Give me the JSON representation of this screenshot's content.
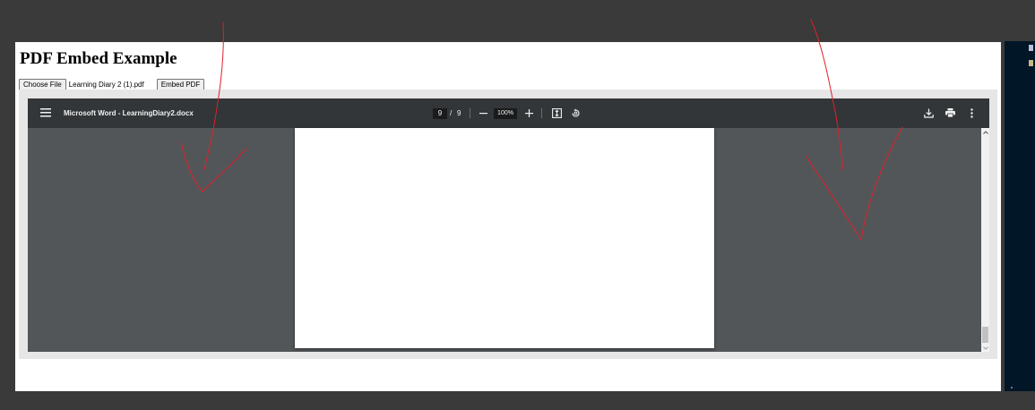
{
  "page": {
    "title": "PDF Embed Example",
    "choose_file_label": "Choose File",
    "file_name": "Learning Diary 2 (1).pdf",
    "embed_button_label": "Embed PDF"
  },
  "viewer": {
    "document_title": "Microsoft Word - LearningDiary2.docx",
    "current_page": "9",
    "page_separator": "/",
    "total_pages": "9",
    "zoom": "100%"
  },
  "colors": {
    "annotation": "#e0202a",
    "toolbar": "#323639",
    "viewer_bg": "#525659"
  },
  "icons": {
    "menu": "menu-icon",
    "zoom_out": "minus-icon",
    "zoom_in": "plus-icon",
    "fit": "fit-page-icon",
    "rotate": "rotate-icon",
    "download": "download-icon",
    "print": "print-icon",
    "more": "more-vertical-icon"
  }
}
